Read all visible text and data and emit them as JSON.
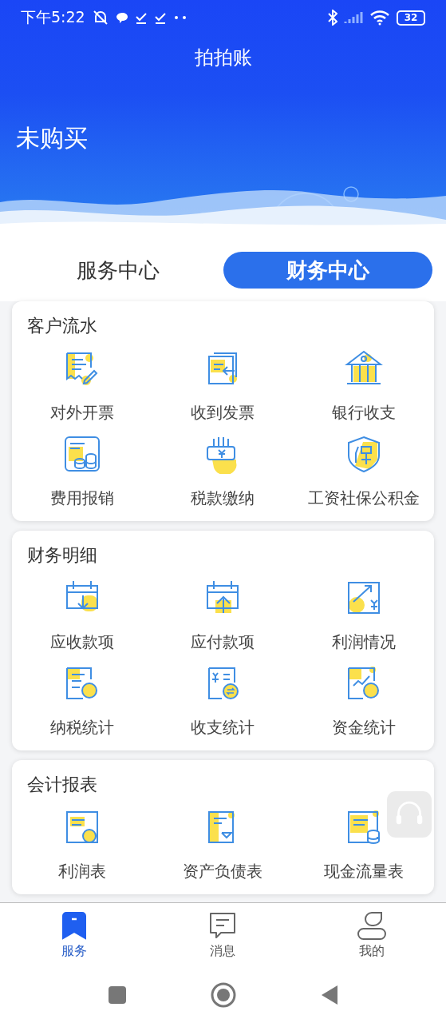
{
  "status_bar": {
    "time": "下午5:22",
    "battery": "32"
  },
  "header": {
    "title": "拍拍账",
    "status": "未购买"
  },
  "tabs": [
    {
      "label": "服务中心",
      "selected": false
    },
    {
      "label": "财务中心",
      "selected": true
    }
  ],
  "sections": [
    {
      "title": "客户流水",
      "items": [
        "对外开票",
        "收到发票",
        "银行收支",
        "费用报销",
        "税款缴纳",
        "工资社保公积金"
      ]
    },
    {
      "title": "财务明细",
      "items": [
        "应收款项",
        "应付款项",
        "利润情况",
        "纳税统计",
        "收支统计",
        "资金统计"
      ]
    },
    {
      "title": "会计报表",
      "items": [
        "利润表",
        "资产负债表",
        "现金流量表"
      ]
    }
  ],
  "bottom_nav": [
    {
      "label": "服务",
      "selected": true
    },
    {
      "label": "消息",
      "selected": false
    },
    {
      "label": "我的",
      "selected": false
    }
  ]
}
